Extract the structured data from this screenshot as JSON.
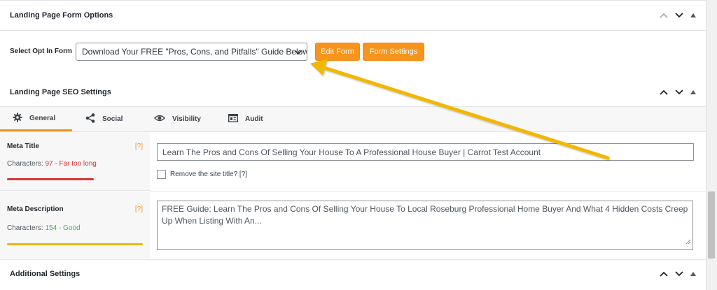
{
  "form_options": {
    "title": "Landing Page Form Options",
    "select_label": "Select Opt In Form",
    "selected_form": "Download Your FREE \"Pros, Cons, and Pitfalls\" Guide Below",
    "edit_form_label": "Edit Form",
    "form_settings_label": "Form Settings"
  },
  "seo": {
    "title": "Landing Page SEO Settings",
    "tabs": [
      {
        "label": "General",
        "icon": "gear-icon"
      },
      {
        "label": "Social",
        "icon": "share-icon"
      },
      {
        "label": "Visibility",
        "icon": "eye-icon"
      },
      {
        "label": "Audit",
        "icon": "audit-icon"
      }
    ],
    "active_tab": "General",
    "meta_title": {
      "label": "Meta Title",
      "help": "[?]",
      "count_prefix": "Characters:",
      "count_status": "97 - Far too long",
      "value": "Learn The Pros and Cons Of Selling Your House To A Professional House Buyer | Carrot Test Account",
      "remove_site_title_label": "Remove the site title? [?]",
      "remove_site_title_checked": false
    },
    "meta_description": {
      "label": "Meta Description",
      "help": "[?]",
      "count_prefix": "Characters:",
      "count_status": "154 - Good",
      "value": "FREE Guide: Learn The Pros and Cons Of Selling Your House To Local Roseburg Professional Home Buyer And What 4 Hidden Costs Creep Up When Listing With An..."
    }
  },
  "additional": {
    "title": "Additional Settings"
  },
  "colors": {
    "accent": "#f7941d",
    "too_long": "#dc3232",
    "good": "#46b450",
    "arrow": "#f2b705"
  }
}
